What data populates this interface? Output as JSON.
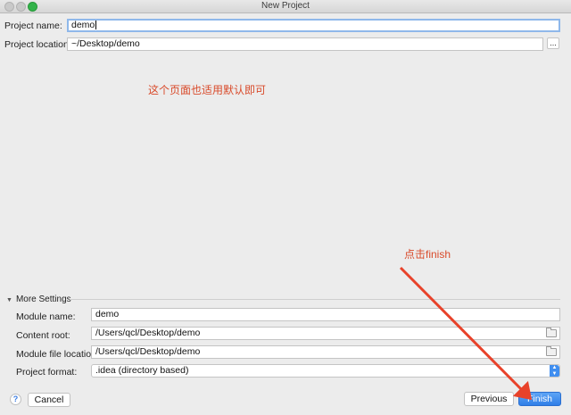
{
  "window": {
    "title": "New Project"
  },
  "form": {
    "project_name_label": "Project name:",
    "project_name_value": "demo",
    "project_location_label": "Project location:",
    "project_location_value": "~/Desktop/demo",
    "browse_label": "..."
  },
  "annotations": {
    "page_note": "这个页面也适用默认即可",
    "finish_note": "点击finish",
    "color": "#d94a2a"
  },
  "more_settings": {
    "title": "More Settings",
    "module_name_label": "Module name:",
    "module_name_value": "demo",
    "content_root_label": "Content root:",
    "content_root_value": "/Users/qcl/Desktop/demo",
    "module_file_location_label": "Module file location:",
    "module_file_location_value": "/Users/qcl/Desktop/demo",
    "project_format_label": "Project format:",
    "project_format_value": ".idea (directory based)"
  },
  "footer": {
    "help_label": "?",
    "cancel_label": "Cancel",
    "previous_label": "Previous",
    "finish_label": "Finish"
  },
  "colors": {
    "accent": "#2f7fe8",
    "focus_ring": "#8fb8ea"
  }
}
